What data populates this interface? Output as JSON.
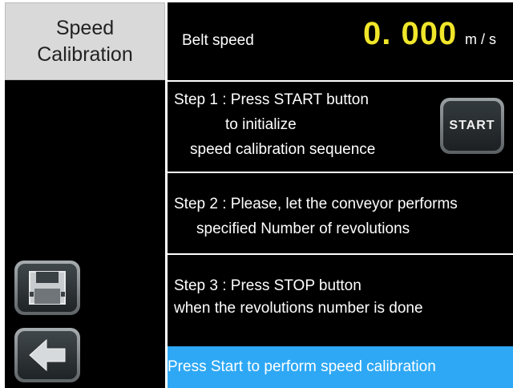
{
  "title": {
    "line1": "Speed",
    "line2": "Calibration"
  },
  "header": {
    "belt_label": "Belt speed",
    "belt_value": "0. 000",
    "belt_unit": "m / s"
  },
  "steps": [
    {
      "lines": [
        "Step 1 : Press START button",
        "to initialize",
        "speed calibration sequence"
      ]
    },
    {
      "lines": [
        "Step 2 : Please, let the conveyor performs",
        "specified Number of revolutions"
      ]
    },
    {
      "lines": [
        "Step 3 : Press STOP button",
        "when the revolutions number is done"
      ]
    }
  ],
  "start_button": {
    "label": "START"
  },
  "side_buttons": {
    "save_icon": "save-icon",
    "back_icon": "back-arrow-icon"
  },
  "status_bar": {
    "text": "Press Start to perform speed calibration"
  },
  "colors": {
    "accent_value": "#f0e62a",
    "status_bg": "#2ea8f5",
    "background": "#000000"
  }
}
